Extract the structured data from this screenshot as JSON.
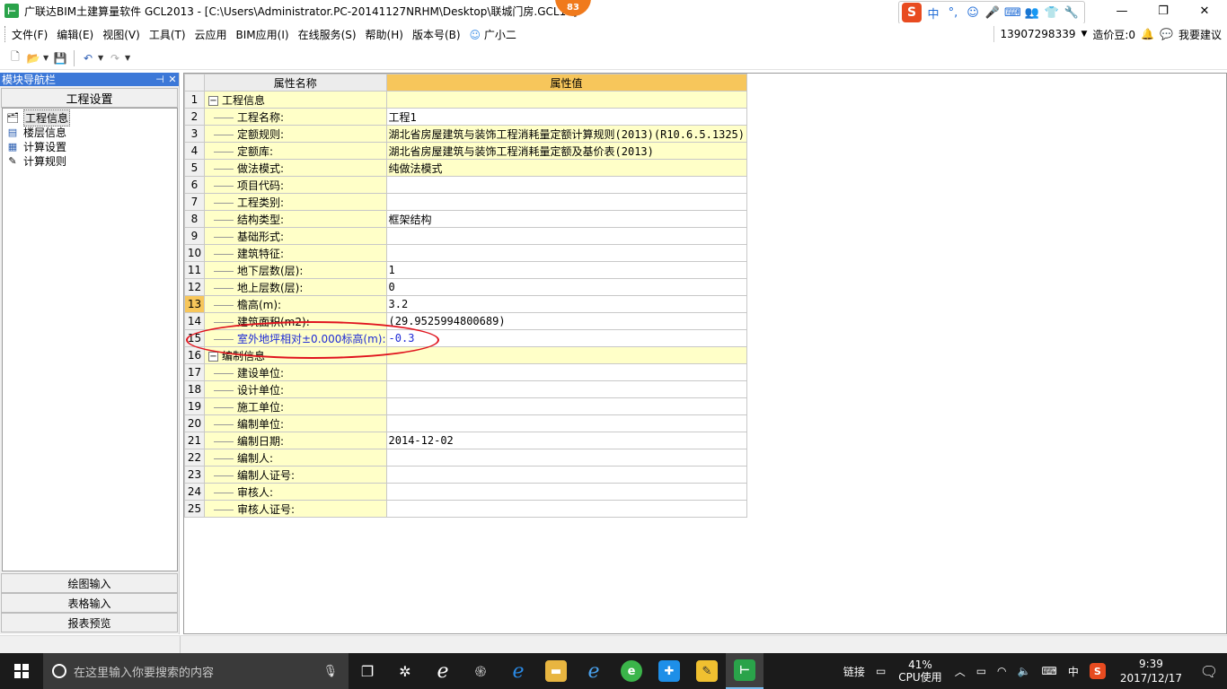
{
  "window": {
    "title": "广联达BIM土建算量软件 GCL2013 - [C:\\Users\\Administrator.PC-20141127NRHM\\Desktop\\联城门房.GCL10]",
    "badge": "83",
    "controls": {
      "minimize": "—",
      "restore": "❐",
      "close": "✕"
    }
  },
  "ime": {
    "logo": "S",
    "items": [
      "中",
      "°,",
      "☺",
      "🎤",
      "⌨",
      "👥",
      "👕",
      "🔧"
    ]
  },
  "menu": {
    "items": [
      "文件(F)",
      "编辑(E)",
      "视图(V)",
      "工具(T)",
      "云应用",
      "BIM应用(I)",
      "在线服务(S)",
      "帮助(H)",
      "版本号(B)",
      "广小二"
    ],
    "user": {
      "phone": "13907298339",
      "coins": "造价豆:0",
      "feedback": "我要建议"
    }
  },
  "nav": {
    "header": "模块导航栏",
    "pin": "ꟾ",
    "close": "✕",
    "section": "工程设置",
    "tree": [
      {
        "label": "工程信息",
        "icon": "project-info-icon",
        "glyph": "🗂"
      },
      {
        "label": "楼层信息",
        "icon": "floor-info-icon",
        "glyph": "▤"
      },
      {
        "label": "计算设置",
        "icon": "calc-settings-icon",
        "glyph": "▦"
      },
      {
        "label": "计算规则",
        "icon": "calc-rules-icon",
        "glyph": "✎"
      }
    ],
    "bottom": [
      "绘图输入",
      "表格输入",
      "报表预览"
    ]
  },
  "grid": {
    "headers": {
      "name": "属性名称",
      "value": "属性值"
    },
    "rows": [
      {
        "no": "1",
        "name": "工程信息",
        "value": "",
        "group": true,
        "expander": "−"
      },
      {
        "no": "2",
        "name": "工程名称:",
        "value": "工程1"
      },
      {
        "no": "3",
        "name": "定额规则:",
        "value": "湖北省房屋建筑与装饰工程消耗量定额计算规则(2013)(R10.6.5.1325)",
        "shaded": true
      },
      {
        "no": "4",
        "name": "定额库:",
        "value": "湖北省房屋建筑与装饰工程消耗量定额及基价表(2013)",
        "shaded": true
      },
      {
        "no": "5",
        "name": "做法模式:",
        "value": "纯做法模式",
        "shaded": true
      },
      {
        "no": "6",
        "name": "项目代码:",
        "value": ""
      },
      {
        "no": "7",
        "name": "工程类别:",
        "value": ""
      },
      {
        "no": "8",
        "name": "结构类型:",
        "value": "框架结构"
      },
      {
        "no": "9",
        "name": "基础形式:",
        "value": ""
      },
      {
        "no": "10",
        "name": "建筑特征:",
        "value": ""
      },
      {
        "no": "11",
        "name": "地下层数(层):",
        "value": "1"
      },
      {
        "no": "12",
        "name": "地上层数(层):",
        "value": "0"
      },
      {
        "no": "13",
        "name": "檐高(m):",
        "value": "3.2",
        "current": true
      },
      {
        "no": "14",
        "name": "建筑面积(m2):",
        "value": "(29.9525994800689)"
      },
      {
        "no": "15",
        "name": "室外地坪相对±0.000标高(m):",
        "value": "-0.3",
        "highlight": true
      },
      {
        "no": "16",
        "name": "编制信息",
        "value": "",
        "group": true,
        "expander": "−"
      },
      {
        "no": "17",
        "name": "建设单位:",
        "value": ""
      },
      {
        "no": "18",
        "name": "设计单位:",
        "value": ""
      },
      {
        "no": "19",
        "name": "施工单位:",
        "value": ""
      },
      {
        "no": "20",
        "name": "编制单位:",
        "value": ""
      },
      {
        "no": "21",
        "name": "编制日期:",
        "value": "2014-12-02"
      },
      {
        "no": "22",
        "name": "编制人:",
        "value": ""
      },
      {
        "no": "23",
        "name": "编制人证号:",
        "value": ""
      },
      {
        "no": "24",
        "name": "审核人:",
        "value": ""
      },
      {
        "no": "25",
        "name": "审核人证号:",
        "value": ""
      }
    ]
  },
  "taskbar": {
    "search_placeholder": "在这里输入你要搜索的内容",
    "tray": {
      "link": "链接",
      "cpu_percent": "41%",
      "cpu_label": "CPU使用",
      "lang": "中",
      "time": "9:39",
      "date": "2017/12/17"
    }
  },
  "colors": {
    "name_cell_bg": "#ffffc8",
    "value_header_bg": "#f7c65b",
    "highlight_text": "#1f2bd6",
    "annotation_ellipse": "#e0141e",
    "nav_header_bg": "#3c78d8"
  }
}
